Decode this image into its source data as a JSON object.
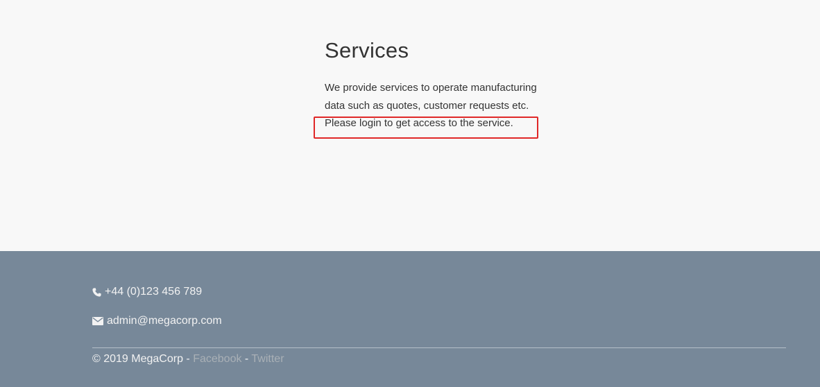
{
  "services": {
    "title": "Services",
    "description_lines": [
      "We provide services to operate manufacturing",
      "data such as quotes, customer requests etc.",
      "Please login to get access to the service."
    ]
  },
  "annotation": {
    "highlight_color": "#e02727"
  },
  "footer": {
    "background": "#778899",
    "phone": "+44 (0)123 456 789",
    "phone_icon": "phone-icon",
    "email": "admin@megacorp.com",
    "email_icon": "envelope-icon",
    "copyright": "© 2019 MegaCorp - ",
    "facebook_label": "Facebook",
    "separator": " - ",
    "twitter_label": "Twitter"
  }
}
